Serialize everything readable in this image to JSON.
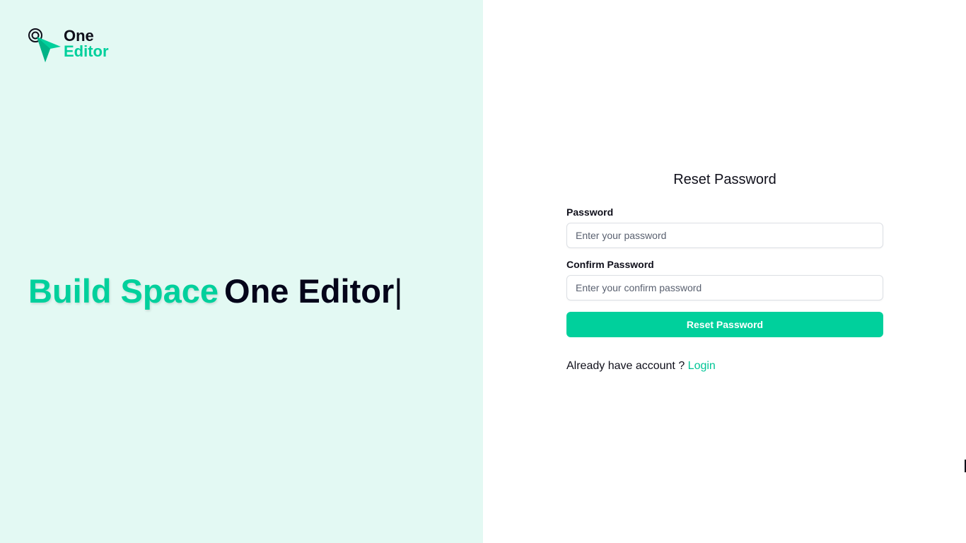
{
  "brand": {
    "logo_line1": "One",
    "logo_line2": "Editor"
  },
  "hero": {
    "green_text": "Build Space",
    "dark_text": "One Editor",
    "cursor": "|"
  },
  "form": {
    "title": "Reset Password",
    "password_label": "Password",
    "password_placeholder": "Enter your password",
    "confirm_label": "Confirm Password",
    "confirm_placeholder": "Enter your confirm password",
    "submit_label": "Reset Password",
    "login_prompt": "Already have account ?",
    "login_link": "Login"
  },
  "colors": {
    "accent": "#00d09c",
    "left_background": "#e3f9f3",
    "text_dark": "#0f0f1a"
  }
}
